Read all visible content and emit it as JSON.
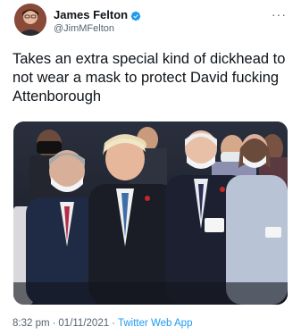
{
  "author": {
    "name": "James Felton",
    "handle": "@JimMFelton",
    "verified_icon": "verified-badge-icon",
    "verified_color": "#1d9bf0"
  },
  "more_icon": "more-options-icon",
  "tweet": {
    "text": "Takes an extra special kind of dickhead to\nnot wear a mask to protect David fucking\nAttenborough"
  },
  "photo": {
    "description_icon": "photo-of-seated-audience"
  },
  "meta": {
    "time": "8:32 pm",
    "sep1": "·",
    "date": "01/11/2021",
    "sep2": "·",
    "app": "Twitter Web App"
  },
  "colors": {
    "text_primary": "#0f1419",
    "text_secondary": "#536471",
    "accent": "#1d9bf0"
  }
}
